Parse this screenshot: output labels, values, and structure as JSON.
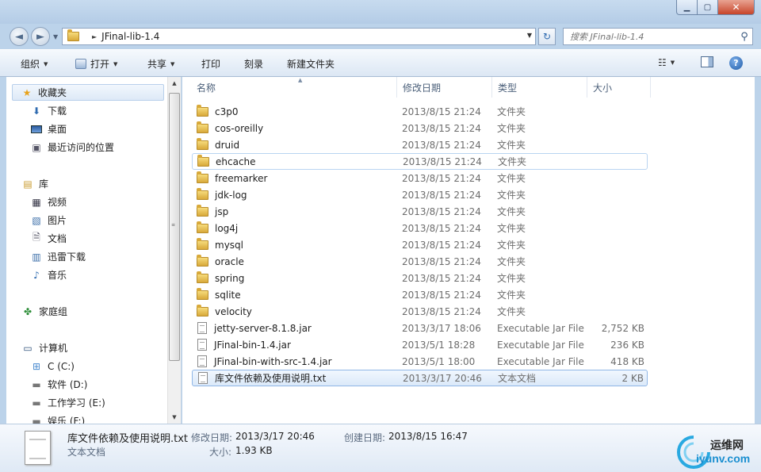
{
  "window": {
    "buttons": {
      "minimize": "▁",
      "maximize": "▢",
      "close": "✕"
    }
  },
  "nav": {
    "back_icon": "◄",
    "forward_icon": "►",
    "address_path": "JFinal-lib-1.4",
    "search_placeholder": "搜索 JFinal-lib-1.4",
    "refresh_icon": "↻"
  },
  "toolbar": {
    "organize": "组织",
    "open": "打开",
    "share": "共享",
    "print": "打印",
    "burn": "刻录",
    "new_folder": "新建文件夹",
    "help": "?"
  },
  "sidebar": {
    "favorites": "收藏夹",
    "downloads": "下载",
    "desktop": "桌面",
    "recent": "最近访问的位置",
    "libraries": "库",
    "videos": "视频",
    "pictures": "图片",
    "documents": "文档",
    "thunder": "迅雷下载",
    "music": "音乐",
    "homegroup": "家庭组",
    "computer": "计算机",
    "drive_c": "C (C:)",
    "drive_d": "软件 (D:)",
    "drive_e": "工作学习 (E:)",
    "drive_f": "娱乐 (F:)"
  },
  "columns": {
    "name": "名称",
    "date": "修改日期",
    "type": "类型",
    "size": "大小"
  },
  "files": [
    {
      "name": "c3p0",
      "date": "2013/8/15 21:24",
      "type": "文件夹",
      "size": "",
      "icon": "folder-icon"
    },
    {
      "name": "cos-oreilly",
      "date": "2013/8/15 21:24",
      "type": "文件夹",
      "size": "",
      "icon": "folder-icon"
    },
    {
      "name": "druid",
      "date": "2013/8/15 21:24",
      "type": "文件夹",
      "size": "",
      "icon": "folder-icon"
    },
    {
      "name": "ehcache",
      "date": "2013/8/15 21:24",
      "type": "文件夹",
      "size": "",
      "icon": "folder-icon"
    },
    {
      "name": "freemarker",
      "date": "2013/8/15 21:24",
      "type": "文件夹",
      "size": "",
      "icon": "folder-icon"
    },
    {
      "name": "jdk-log",
      "date": "2013/8/15 21:24",
      "type": "文件夹",
      "size": "",
      "icon": "folder-icon"
    },
    {
      "name": "jsp",
      "date": "2013/8/15 21:24",
      "type": "文件夹",
      "size": "",
      "icon": "folder-icon"
    },
    {
      "name": "log4j",
      "date": "2013/8/15 21:24",
      "type": "文件夹",
      "size": "",
      "icon": "folder-icon"
    },
    {
      "name": "mysql",
      "date": "2013/8/15 21:24",
      "type": "文件夹",
      "size": "",
      "icon": "folder-icon"
    },
    {
      "name": "oracle",
      "date": "2013/8/15 21:24",
      "type": "文件夹",
      "size": "",
      "icon": "folder-icon"
    },
    {
      "name": "spring",
      "date": "2013/8/15 21:24",
      "type": "文件夹",
      "size": "",
      "icon": "folder-icon"
    },
    {
      "name": "sqlite",
      "date": "2013/8/15 21:24",
      "type": "文件夹",
      "size": "",
      "icon": "folder-icon"
    },
    {
      "name": "velocity",
      "date": "2013/8/15 21:24",
      "type": "文件夹",
      "size": "",
      "icon": "folder-icon"
    },
    {
      "name": "jetty-server-8.1.8.jar",
      "date": "2013/3/17 18:06",
      "type": "Executable Jar File",
      "size": "2,752 KB",
      "icon": "jar-file-icon"
    },
    {
      "name": "JFinal-bin-1.4.jar",
      "date": "2013/5/1 18:28",
      "type": "Executable Jar File",
      "size": "236 KB",
      "icon": "jar-file-icon"
    },
    {
      "name": "JFinal-bin-with-src-1.4.jar",
      "date": "2013/5/1 18:00",
      "type": "Executable Jar File",
      "size": "418 KB",
      "icon": "jar-file-icon"
    },
    {
      "name": "库文件依赖及使用说明.txt",
      "date": "2013/3/17 20:46",
      "type": "文本文档",
      "size": "2 KB",
      "icon": "text-file-icon"
    }
  ],
  "details": {
    "file_name": "库文件依赖及使用说明.txt",
    "file_type": "文本文档",
    "modified_label": "修改日期:",
    "modified_value": "2013/3/17 20:46",
    "created_label": "创建日期:",
    "created_value": "2013/8/15 16:47",
    "size_label": "大小:",
    "size_value": "1.93 KB"
  },
  "watermark": {
    "line1": "运维网",
    "line2": "iyunv.com"
  }
}
